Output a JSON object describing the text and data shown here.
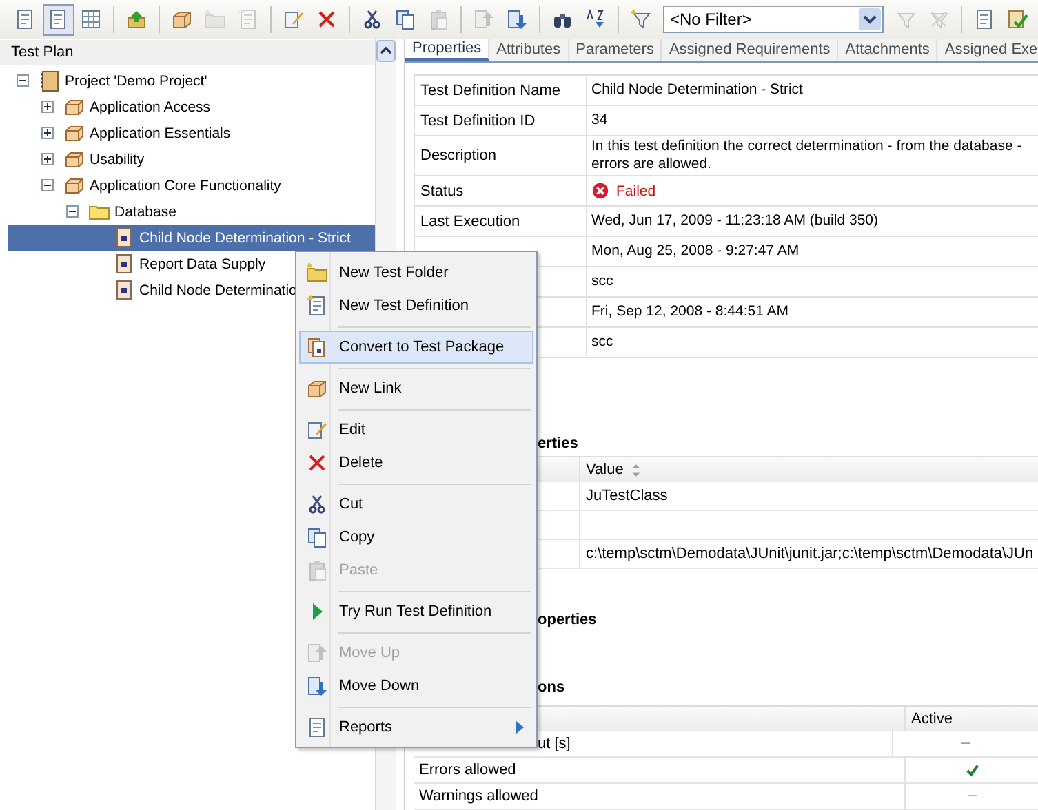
{
  "toolbar": [
    {
      "kind": "button",
      "disabled": false,
      "pressed": false
    },
    {
      "kind": "button",
      "disabled": false,
      "pressed": true
    },
    {
      "kind": "button",
      "disabled": false,
      "pressed": false
    },
    {
      "kind": "separator"
    },
    {
      "kind": "button",
      "disabled": false,
      "pressed": false
    },
    {
      "kind": "separator"
    },
    {
      "kind": "button",
      "disabled": false,
      "pressed": false
    },
    {
      "kind": "button",
      "disabled": true,
      "pressed": false
    },
    {
      "kind": "button",
      "disabled": true,
      "pressed": false
    },
    {
      "kind": "separator"
    },
    {
      "kind": "button",
      "disabled": false,
      "pressed": false
    },
    {
      "kind": "button",
      "disabled": false,
      "pressed": false
    },
    {
      "kind": "separator"
    },
    {
      "kind": "button",
      "disabled": false,
      "pressed": false
    },
    {
      "kind": "button",
      "disabled": false,
      "pressed": false
    },
    {
      "kind": "button",
      "disabled": true,
      "pressed": false
    },
    {
      "kind": "separator"
    },
    {
      "kind": "button",
      "disabled": true,
      "pressed": false
    },
    {
      "kind": "button",
      "disabled": false,
      "pressed": false
    },
    {
      "kind": "separator"
    },
    {
      "kind": "button",
      "disabled": false,
      "pressed": false
    },
    {
      "kind": "button",
      "disabled": false,
      "pressed": false
    },
    {
      "kind": "separator"
    },
    {
      "kind": "button",
      "disabled": false,
      "pressed": false
    },
    {
      "kind": "filter",
      "value": "<No Filter>"
    },
    {
      "kind": "button",
      "disabled": true,
      "pressed": false
    },
    {
      "kind": "button",
      "disabled": true,
      "pressed": false
    },
    {
      "kind": "separator"
    },
    {
      "kind": "button",
      "disabled": false,
      "pressed": false
    },
    {
      "kind": "button",
      "disabled": false,
      "pressed": false
    }
  ],
  "tree_panel": {
    "title": "Test Plan",
    "items": [
      {
        "label": "Project 'Demo Project'",
        "kind": "project",
        "expanded": true,
        "selected": false,
        "children": [
          {
            "label": "Application Access",
            "kind": "package",
            "expanded": false,
            "selected": false
          },
          {
            "label": "Application Essentials",
            "kind": "package",
            "expanded": false,
            "selected": false
          },
          {
            "label": "Usability",
            "kind": "package",
            "expanded": false,
            "selected": false
          },
          {
            "label": "Application Core Functionality",
            "kind": "package",
            "expanded": true,
            "selected": false,
            "children": [
              {
                "label": "Database",
                "kind": "folder",
                "expanded": true,
                "selected": false,
                "children": [
                  {
                    "label": "Child Node Determination - Strict",
                    "kind": "test",
                    "selected": true
                  },
                  {
                    "label": "Report Data Supply",
                    "kind": "test",
                    "selected": false
                  },
                  {
                    "label": "Child Node Determinatio",
                    "kind": "test",
                    "selected": false
                  }
                ]
              }
            ]
          }
        ]
      }
    ]
  },
  "tabs": [
    {
      "label": "Properties",
      "selected": true
    },
    {
      "label": "Attributes",
      "selected": false
    },
    {
      "label": "Parameters",
      "selected": false
    },
    {
      "label": "Assigned Requirements",
      "selected": false
    },
    {
      "label": "Attachments",
      "selected": false
    },
    {
      "label": "Assigned Exe",
      "selected": false
    }
  ],
  "properties": [
    {
      "label": "Test Definition Name",
      "value": "Child Node Determination - Strict"
    },
    {
      "label": "Test Definition ID",
      "value": "34"
    },
    {
      "label": "Description",
      "value": "In this test definition the correct determination - from the database -\nerrors are allowed."
    },
    {
      "label": "Status",
      "value": "Failed",
      "kind": "failed"
    },
    {
      "label": "Last Execution",
      "value": "Wed, Jun 17, 2009 - 11:23:18 AM (build 350)"
    },
    {
      "value": "Mon, Aug 25, 2008 - 9:27:47 AM"
    },
    {
      "value": "scc"
    },
    {
      "value": "Fri, Sep 12, 2008 - 8:44:51 AM"
    },
    {
      "value": "scc"
    }
  ],
  "sections": [
    {
      "heading": "erties",
      "table": {
        "columns": [
          "",
          "Value"
        ],
        "rows": [
          [
            "",
            "JuTestClass"
          ],
          [
            "",
            ""
          ],
          [
            "",
            "c:\\temp\\sctm\\Demodata\\JUnit\\junit.jar;c:\\temp\\sctm\\Demodata\\JUn"
          ]
        ]
      }
    },
    {
      "heading": "operties"
    },
    {
      "heading": "ons",
      "options": {
        "column": "Active",
        "rows": [
          {
            "label": "ut [s]",
            "active": false
          },
          {
            "label": "Errors allowed",
            "active": true
          },
          {
            "label": "Warnings allowed",
            "active": false
          }
        ]
      }
    }
  ],
  "context_menu": [
    {
      "kind": "item",
      "label": "New Test Folder",
      "disabled": false,
      "selected": false
    },
    {
      "kind": "item",
      "label": "New Test Definition",
      "disabled": false,
      "selected": false
    },
    {
      "kind": "separator"
    },
    {
      "kind": "item",
      "label": "Convert to Test Package",
      "disabled": false,
      "selected": true
    },
    {
      "kind": "separator"
    },
    {
      "kind": "item",
      "label": "New Link",
      "disabled": false,
      "selected": false
    },
    {
      "kind": "separator"
    },
    {
      "kind": "item",
      "label": "Edit",
      "disabled": false,
      "selected": false
    },
    {
      "kind": "item",
      "label": "Delete",
      "disabled": false,
      "selected": false
    },
    {
      "kind": "separator"
    },
    {
      "kind": "item",
      "label": "Cut",
      "disabled": false,
      "selected": false
    },
    {
      "kind": "item",
      "label": "Copy",
      "disabled": false,
      "selected": false
    },
    {
      "kind": "item",
      "label": "Paste",
      "disabled": true,
      "selected": false
    },
    {
      "kind": "separator"
    },
    {
      "kind": "item",
      "label": "Try Run Test Definition",
      "disabled": false,
      "selected": false
    },
    {
      "kind": "separator"
    },
    {
      "kind": "item",
      "label": "Move Up",
      "disabled": true,
      "selected": false
    },
    {
      "kind": "item",
      "label": "Move Down",
      "disabled": false,
      "selected": false
    },
    {
      "kind": "separator"
    },
    {
      "kind": "submenu",
      "label": "Reports",
      "disabled": false,
      "selected": false
    }
  ]
}
